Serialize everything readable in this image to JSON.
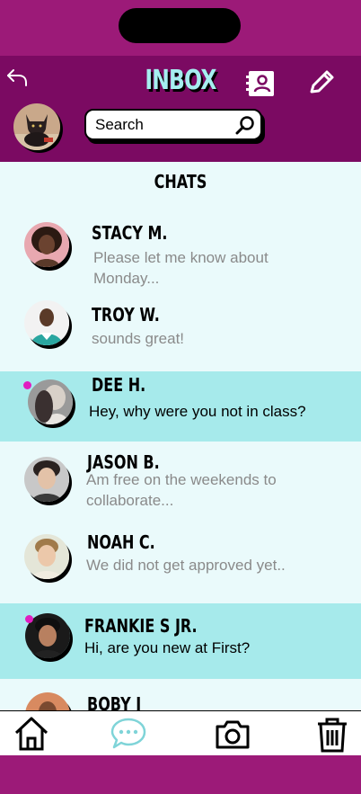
{
  "header": {
    "title": "INBOX",
    "icons": [
      "back-arrow-icon",
      "contacts-book-icon",
      "pencil-icon",
      "search-icon"
    ]
  },
  "search": {
    "placeholder": "Search"
  },
  "section_title": "CHATS",
  "chats": [
    {
      "name": "STACY  M.",
      "message": "Please let me know about Monday...",
      "unread": false
    },
    {
      "name": "TROY W.",
      "message": "sounds great!",
      "unread": false
    },
    {
      "name": "DEE H.",
      "message": "Hey, why were you not in class?",
      "unread": true
    },
    {
      "name": "JASON  B.",
      "message": "Am free on the weekends to collaborate...",
      "unread": false
    },
    {
      "name": "NOAH C.",
      "message": "We did not get approved yet..",
      "unread": false
    },
    {
      "name": "FRANKIE S JR.",
      "message": "Hi, are you new at First?",
      "unread": true
    },
    {
      "name": "BOBY J",
      "message": "",
      "unread": false
    }
  ],
  "bottom_nav": {
    "items": [
      "home-icon",
      "chat-bubble-icon",
      "camera-icon",
      "trash-icon"
    ],
    "active": "chat-bubble-icon"
  },
  "colors": {
    "frame_magenta": "#9c1a78",
    "header_magenta": "#7b0a62",
    "accent_cyan": "#a6eef0",
    "unread_row": "#a6eaeb",
    "unread_dot": "#e01ec0",
    "background": "#eafafb"
  }
}
